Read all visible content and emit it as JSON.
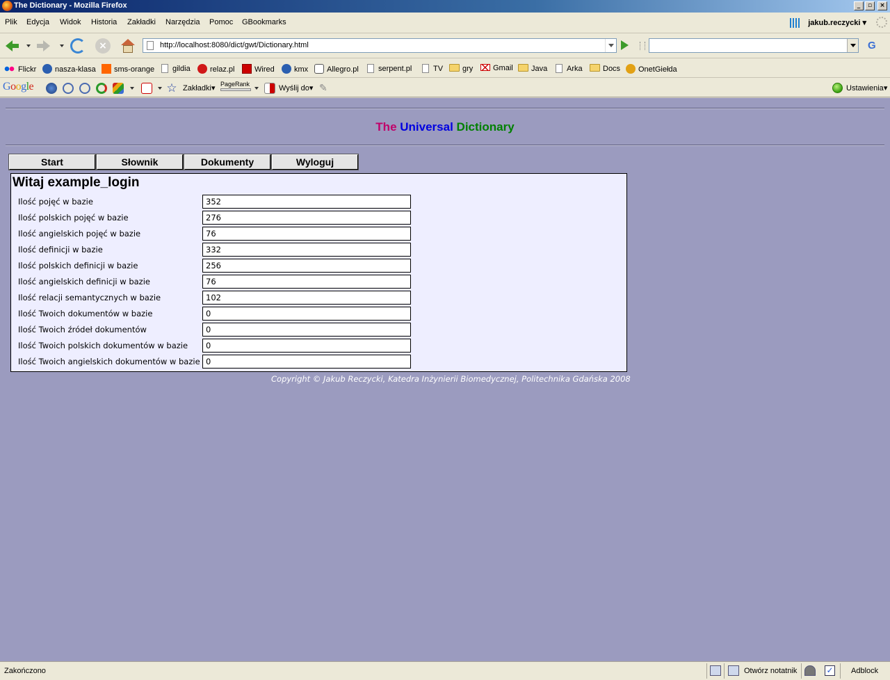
{
  "window": {
    "title": "The Dictionary - Mozilla Firefox"
  },
  "menu": {
    "items": [
      "Plik",
      "Edycja",
      "Widok",
      "Historia",
      "Zakładki",
      "Narzędzia",
      "Pomoc",
      "GBookmarks"
    ],
    "user": "jakub.reczycki"
  },
  "navbar": {
    "url": "http://localhost:8080/dict/gwt/Dictionary.html",
    "search_value": "",
    "search_engine": "G"
  },
  "bookmarks": {
    "items": [
      "Flickr",
      "nasza-klasa",
      "sms-orange",
      "gildia",
      "relaz.pl",
      "Wired",
      "kmx",
      "Allegro.pl",
      "serpent.pl",
      "TV",
      "gry",
      "Gmail",
      "Java",
      "Arka",
      "Docs",
      "OnetGiełda"
    ]
  },
  "google_toolbar": {
    "logo": "Google",
    "bookmarks_label": "Zakładki",
    "pagerank_label": "PageRank",
    "send_label": "Wyślij do",
    "settings_label": "Ustawienia"
  },
  "page": {
    "title_parts": {
      "the": "The",
      "universal": "Universal",
      "dictionary": "Dictionary"
    },
    "colors": {
      "the": "#c0006a",
      "universal": "#0000e0",
      "dictionary": "#008000",
      "background": "#9b9bbf"
    },
    "tabs": [
      "Start",
      "Słownik",
      "Dokumenty",
      "Wyloguj"
    ],
    "welcome": "Witaj example_login",
    "stats": [
      {
        "label": "Ilość pojęć w bazie",
        "value": "352"
      },
      {
        "label": "Ilość polskich pojęć w bazie",
        "value": "276"
      },
      {
        "label": "Ilość angielskich pojęć w bazie",
        "value": "76"
      },
      {
        "label": "Ilość definicji w bazie",
        "value": "332"
      },
      {
        "label": "Ilość polskich definicji w bazie",
        "value": "256"
      },
      {
        "label": "Ilość angielskich definicji w bazie",
        "value": "76"
      },
      {
        "label": "Ilość relacji semantycznych w bazie",
        "value": "102"
      },
      {
        "label": "Ilość Twoich dokumentów w bazie",
        "value": "0"
      },
      {
        "label": "Ilość Twoich źródeł dokumentów",
        "value": "0"
      },
      {
        "label": "Ilość Twoich polskich dokumentów w bazie",
        "value": "0"
      },
      {
        "label": "Ilość Twoich angielskich dokumentów w bazie",
        "value": "0"
      }
    ],
    "copyright": "Copyright © Jakub Reczycki, Katedra Inżynierii Biomedycznej, Politechnika Gdańska 2008"
  },
  "status": {
    "text": "Zakończono",
    "notepad": "Otwórz notatnik",
    "adblock": "Adblock"
  }
}
